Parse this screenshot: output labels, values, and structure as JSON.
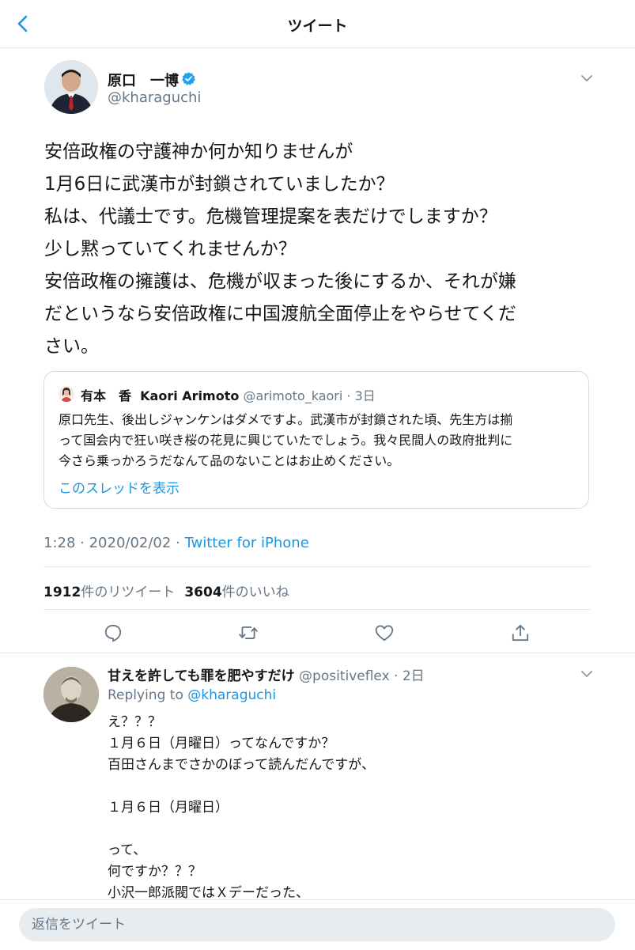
{
  "nav": {
    "title": "ツイート"
  },
  "tweet": {
    "author_name": "原口　一博",
    "author_handle": "@kharaguchi",
    "verified": true,
    "text_lines": [
      "安倍政権の守護神か何か知りませんが",
      "1月6日に武漢市が封鎖されていましたか？",
      "私は、代議士です。危機管理提案を表だけでしますか？",
      "少し黙っていてくれませんか？",
      "安倍政権の擁護は、危機が収まった後にするか、それが嫌",
      "だというなら安倍政権に中国渡航全面停止をやらせてくだ",
      "さい。"
    ],
    "timestamp": "1:28 · 2020/02/02 · ",
    "source": "Twitter for iPhone"
  },
  "quote": {
    "author_name": "有本　香  Kaori Arimoto",
    "author_handle": "@arimoto_kaori · 3日",
    "text_lines": [
      "原口先生、後出しジャンケンはダメですよ。武漢市が封鎖された頃、先生方は揃",
      "って国会内で狂い咲き桜の花見に興じていたでしょう。我々民間人の政府批判に",
      "今さら乗っかろうだなんて品のないことはお止めください。"
    ],
    "show_thread": "このスレッドを表示"
  },
  "stats": {
    "retweets_count": "1912",
    "retweets_label": "件のリツイート",
    "likes_count": "3604",
    "likes_label": "件のいいね"
  },
  "actions": [
    "reply-icon",
    "retweet-icon",
    "like-icon",
    "share-icon"
  ],
  "reply": {
    "author_name": "甘えを許しても罪を肥やすだけ",
    "author_handle": "@positiveflex · 2日",
    "replying_prefix": "Replying to ",
    "replying_handle": "@kharaguchi",
    "text_lines": [
      "え？？？",
      "１月６日（月曜日）ってなんですか？",
      "百田さんまでさかのぼって読んだんですが、",
      "",
      "１月６日（月曜日）",
      "",
      "って、",
      "何ですか？？？",
      "小沢一郎派閥ではＸデーだった、"
    ]
  },
  "composer": {
    "placeholder": "返信をツイート"
  },
  "colors": {
    "accent": "#1b95e0",
    "secondary_text": "#657786",
    "border": "#e1e8ed"
  }
}
